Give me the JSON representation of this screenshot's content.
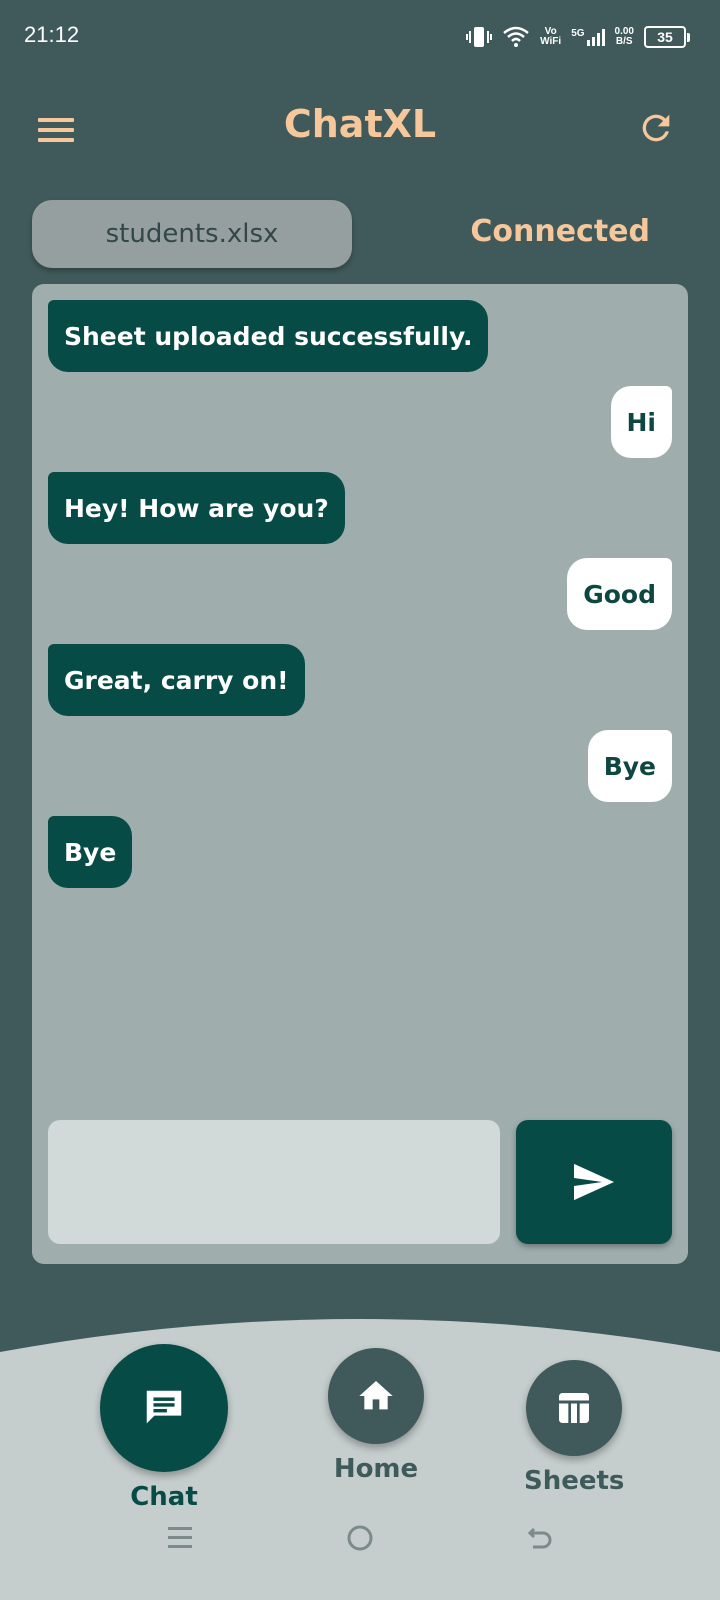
{
  "status_bar": {
    "time": "21:12",
    "network_top": "Vo",
    "network_bottom": "WiFi",
    "signal_label": "5G",
    "speed_top": "0.00",
    "speed_bottom": "B/S",
    "battery": "35"
  },
  "app_bar": {
    "title": "ChatXL",
    "menu_icon": "hamburger-menu-icon",
    "refresh_icon": "refresh-icon"
  },
  "file": {
    "name": "students.xlsx",
    "status": "Connected"
  },
  "messages": [
    {
      "sender": "bot",
      "text": "Sheet uploaded successfully."
    },
    {
      "sender": "user",
      "text": "Hi"
    },
    {
      "sender": "bot",
      "text": "Hey! How are you?"
    },
    {
      "sender": "user",
      "text": "Good"
    },
    {
      "sender": "bot",
      "text": "Great, carry on!"
    },
    {
      "sender": "user",
      "text": "Bye"
    },
    {
      "sender": "bot",
      "text": "Bye"
    }
  ],
  "composer": {
    "value": "",
    "send_icon": "send-icon"
  },
  "bottom_nav": {
    "items": [
      {
        "label": "Chat",
        "icon": "chat-icon",
        "active": true
      },
      {
        "label": "Home",
        "icon": "home-icon",
        "active": false
      },
      {
        "label": "Sheets",
        "icon": "table-icon",
        "active": false
      }
    ]
  },
  "colors": {
    "background": "#40595A",
    "accent": "#F6C79A",
    "primary": "#064B45",
    "panel": "#9FADAD",
    "nav_background": "#C5CECD"
  }
}
